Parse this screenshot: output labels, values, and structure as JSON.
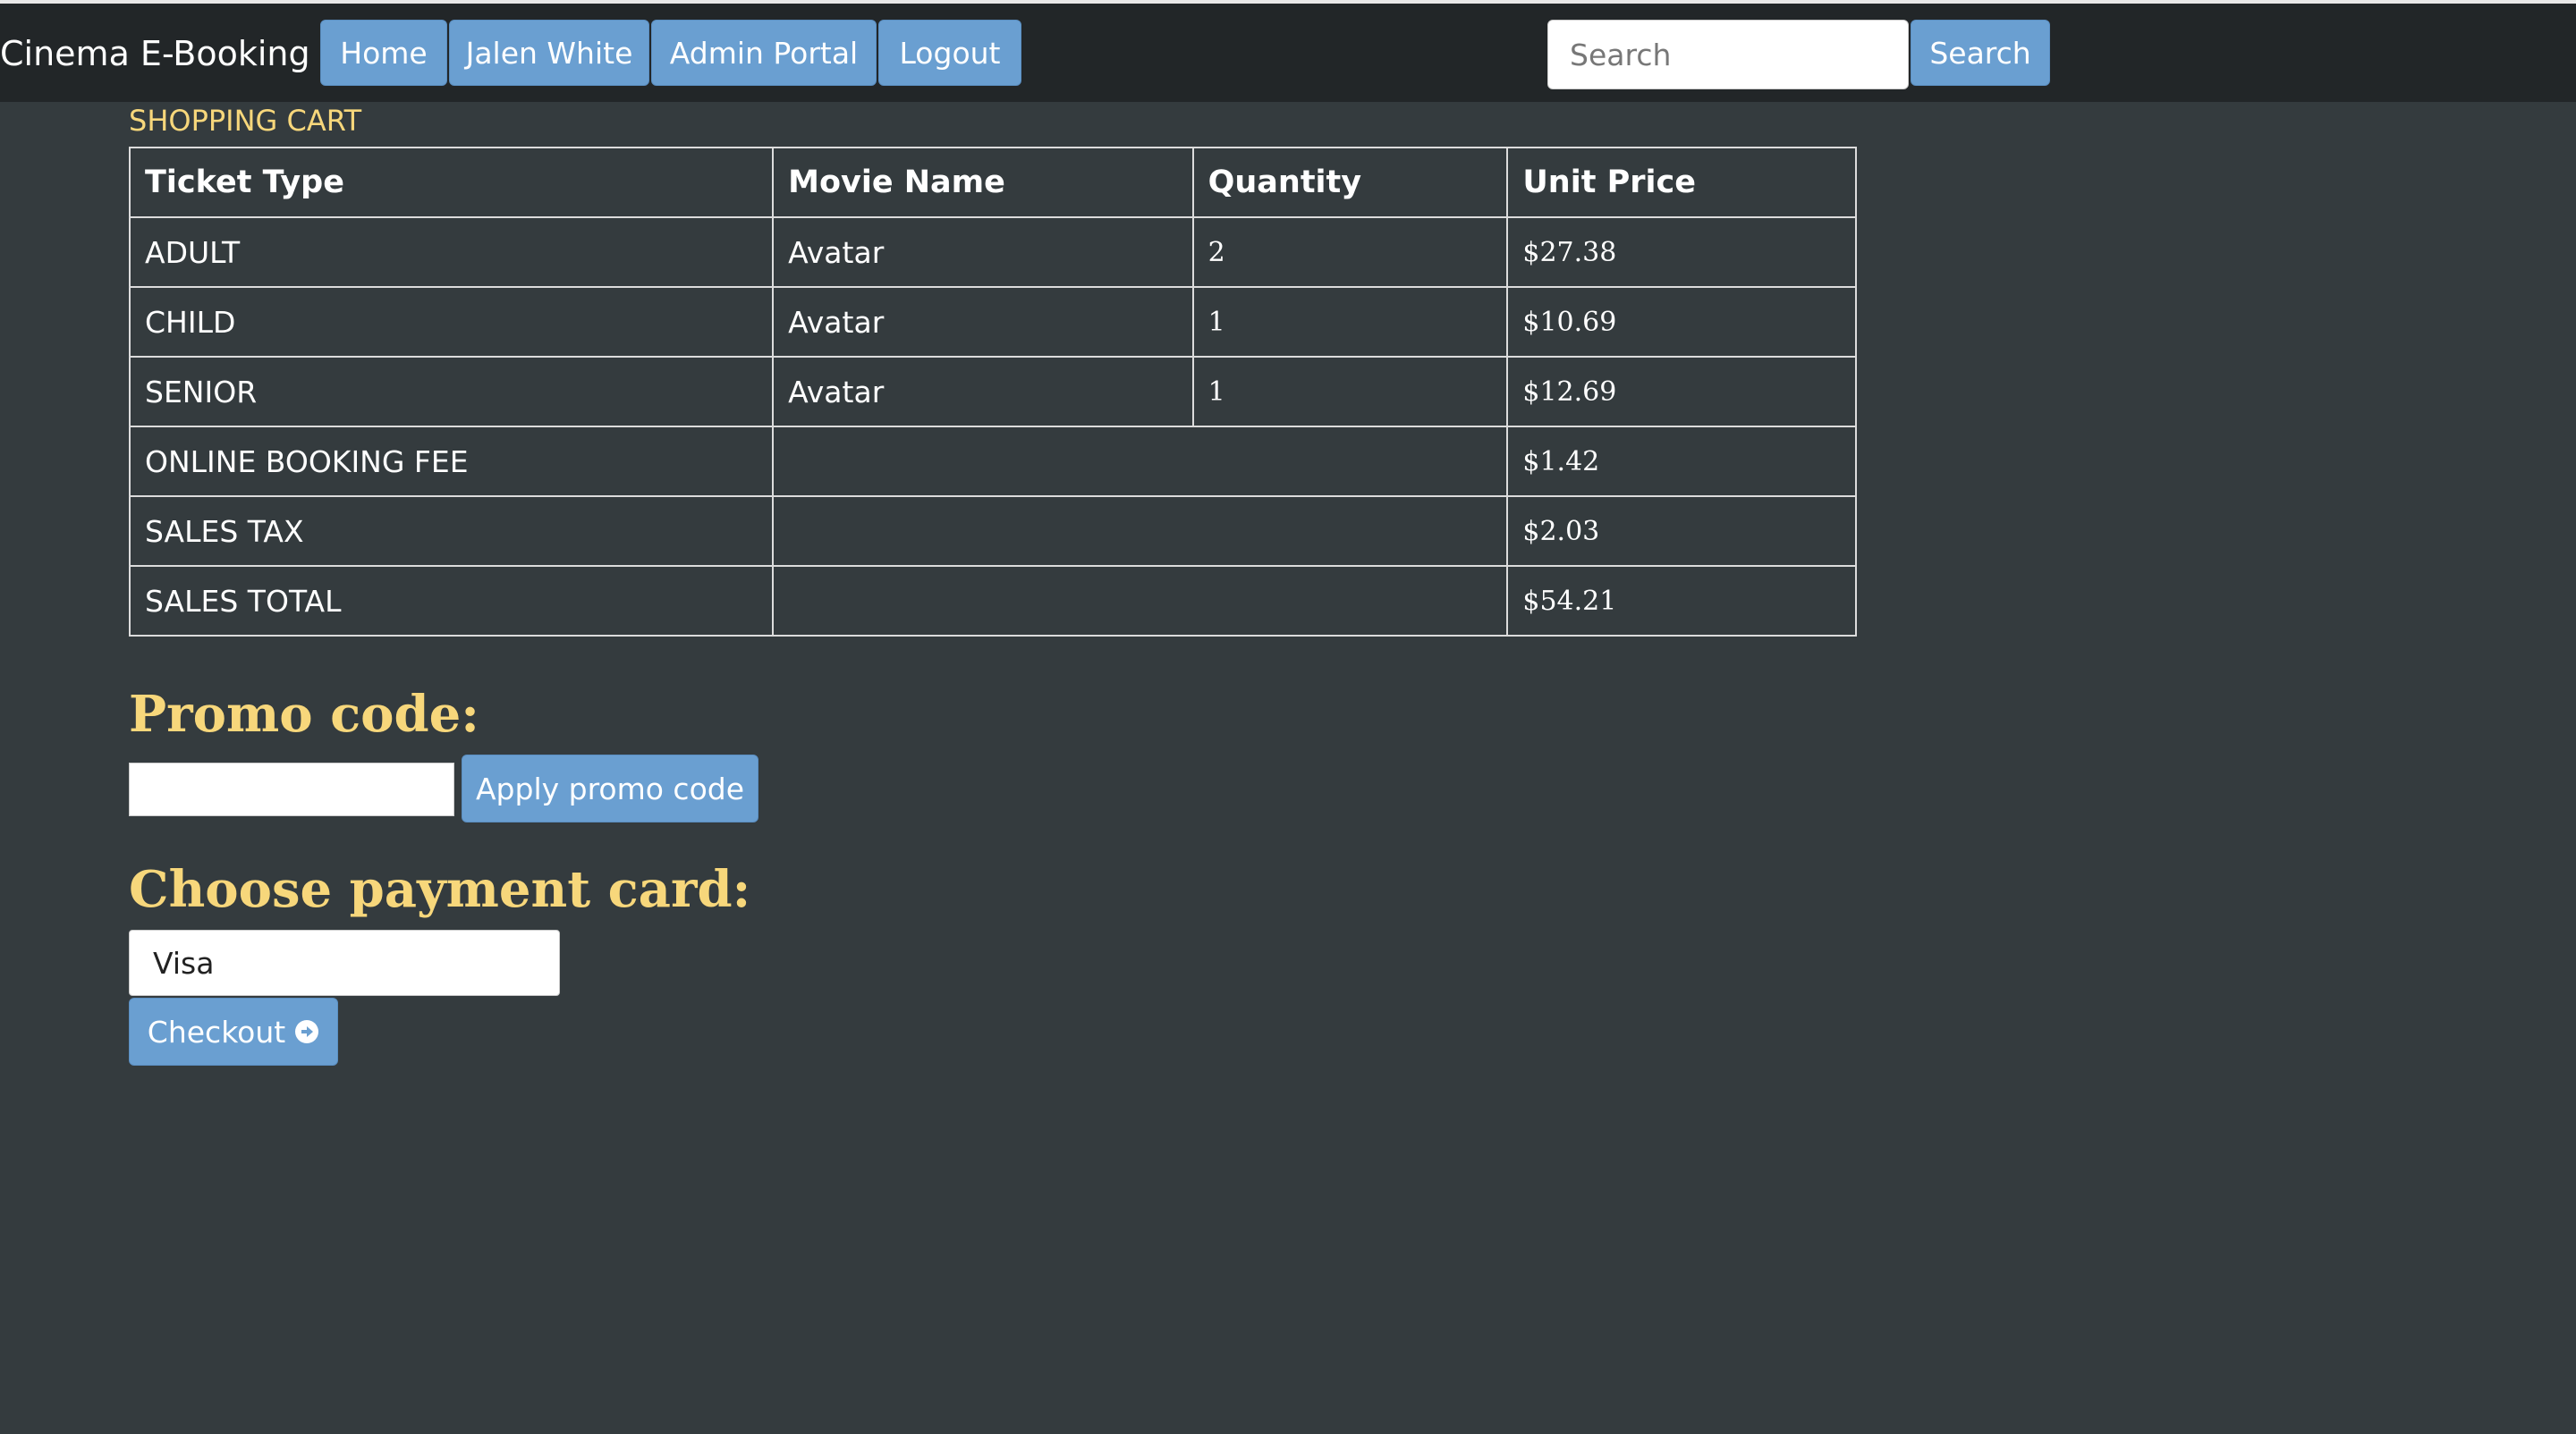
{
  "navbar": {
    "brand": "Cinema E-Booking",
    "home_label": "Home",
    "user_label": "Jalen White",
    "admin_label": "Admin Portal",
    "logout_label": "Logout",
    "search_placeholder": "Search",
    "search_value": "",
    "search_button_label": "Search"
  },
  "cart": {
    "title": "SHOPPING CART",
    "columns": [
      "Ticket Type",
      "Movie Name",
      "Quantity",
      "Unit Price"
    ],
    "tickets": [
      {
        "type": "ADULT",
        "movie": "Avatar",
        "quantity": "2",
        "price": "$27.38"
      },
      {
        "type": "CHILD",
        "movie": "Avatar",
        "quantity": "1",
        "price": "$10.69"
      },
      {
        "type": "SENIOR",
        "movie": "Avatar",
        "quantity": "1",
        "price": "$12.69"
      }
    ],
    "fees": [
      {
        "label": "ONLINE BOOKING FEE",
        "amount": "$1.42"
      },
      {
        "label": "SALES TAX",
        "amount": "$2.03"
      },
      {
        "label": "SALES TOTAL",
        "amount": "$54.21"
      }
    ]
  },
  "promo": {
    "heading": "Promo code:",
    "input_value": "",
    "apply_label": "Apply promo code"
  },
  "payment": {
    "heading": "Choose payment card:",
    "selected_card": "Visa",
    "checkout_label": "Checkout"
  },
  "colors": {
    "background": "#343b3e",
    "navbar": "#222628",
    "button": "#6a9fd1",
    "accent_yellow": "#f7d77b"
  }
}
